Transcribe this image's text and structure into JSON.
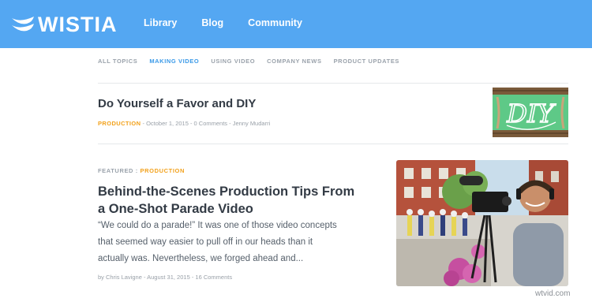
{
  "brand": {
    "name": "WISTIA",
    "header_color": "#54a7f2",
    "accent": "#3b9ae8",
    "category_color": "#f2a11b"
  },
  "nav": {
    "items": [
      "Library",
      "Blog",
      "Community"
    ]
  },
  "topics": {
    "items": [
      "ALL TOPICS",
      "MAKING VIDEO",
      "USING VIDEO",
      "COMPANY NEWS",
      "PRODUCT UPDATES"
    ],
    "active": "MAKING VIDEO"
  },
  "post1": {
    "title": "Do Yourself a Favor and DIY",
    "category": "PRODUCTION",
    "meta_rest": " - October 1, 2015 - 0 Comments - Jenny Mudarri",
    "thumb_text": "DIY"
  },
  "post2": {
    "featured": "FEATURED",
    "separator": " : ",
    "category": "PRODUCTION",
    "title": "Behind-the-Scenes Production Tips From a One-Shot Parade Video",
    "excerpt": "“We could do a parade!” It was one of those video concepts that seemed way easier to pull off in our heads than it actually was. Nevertheless, we forged ahead and...",
    "byline": "by Chris Lavigne - August 31, 2015 - 16 Comments"
  },
  "watermark": "wtvid.com"
}
